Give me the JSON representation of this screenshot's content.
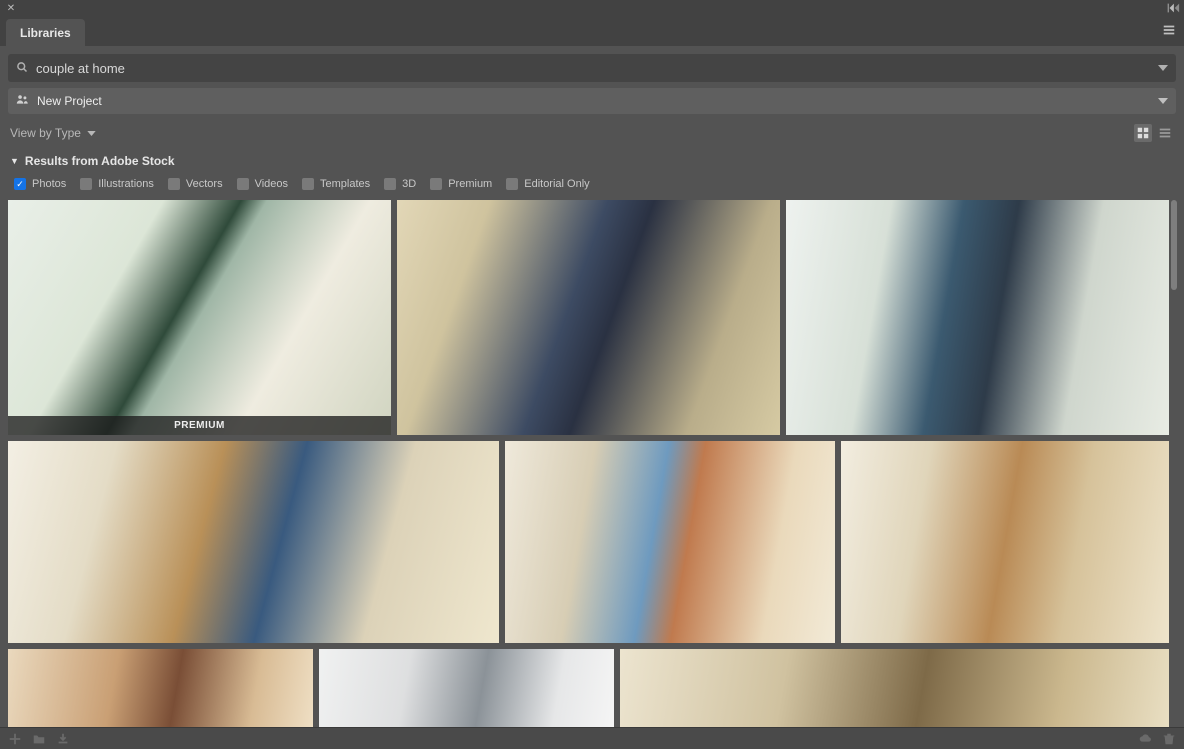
{
  "tabbar": {
    "active_tab": "Libraries"
  },
  "search": {
    "value": "couple at home"
  },
  "project": {
    "name": "New Project"
  },
  "viewby": {
    "label": "View by Type"
  },
  "results_header": "Results from Adobe Stock",
  "filters": [
    {
      "label": "Photos",
      "checked": true
    },
    {
      "label": "Illustrations",
      "checked": false
    },
    {
      "label": "Vectors",
      "checked": false
    },
    {
      "label": "Videos",
      "checked": false
    },
    {
      "label": "Templates",
      "checked": false
    },
    {
      "label": "3D",
      "checked": false
    },
    {
      "label": "Premium",
      "checked": false
    },
    {
      "label": "Editorial Only",
      "checked": false
    }
  ],
  "badges": {
    "premium": "PREMIUM"
  }
}
